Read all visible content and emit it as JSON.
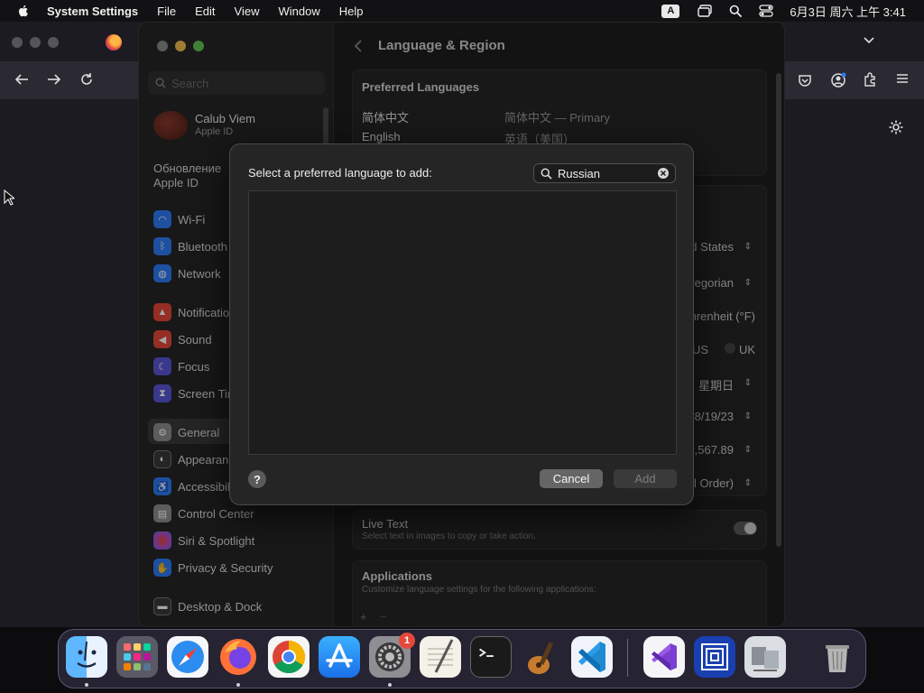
{
  "menubar": {
    "app_name": "System Settings",
    "menus": [
      "File",
      "Edit",
      "View",
      "Window",
      "Help"
    ],
    "input_source": "A",
    "clock": "6月3日 周六 上午 3:41"
  },
  "settings": {
    "search_placeholder": "Search",
    "account": {
      "name": "Calub Viem",
      "sub": "Apple ID"
    },
    "update_notice": "Обновление Apple ID",
    "sidebar": [
      {
        "label": "Wi-Fi",
        "color": "#2d7cf6"
      },
      {
        "label": "Bluetooth",
        "color": "#2d7cf6"
      },
      {
        "label": "Network",
        "color": "#2d7cf6"
      },
      {
        "label": "Notifications",
        "color": "#e5483a"
      },
      {
        "label": "Sound",
        "color": "#e5483a"
      },
      {
        "label": "Focus",
        "color": "#5856d6"
      },
      {
        "label": "Screen Time",
        "color": "#5856d6"
      },
      {
        "label": "General",
        "color": "#8e8e93"
      },
      {
        "label": "Appearance",
        "color": "#3a3a3c"
      },
      {
        "label": "Accessibility",
        "color": "#2d7cf6"
      },
      {
        "label": "Control Center",
        "color": "#8e8e93"
      },
      {
        "label": "Siri & Spotlight",
        "color": "#b34fd0"
      },
      {
        "label": "Privacy & Security",
        "color": "#2d7cf6"
      },
      {
        "label": "Desktop & Dock",
        "color": "#3a3a3c"
      }
    ],
    "content": {
      "title": "Language & Region",
      "preferred_heading": "Preferred Languages",
      "languages": [
        {
          "name": "简体中文",
          "detail": "简体中文 — Primary"
        },
        {
          "name": "English",
          "detail": "英语（美国）"
        }
      ],
      "region_values": [
        "United States",
        "Gregorian",
        "Fahrenheit (°F)",
        "星期日",
        "8/19/23",
        "1,567.89",
        "(Alphabetical Order)"
      ],
      "measurement": {
        "us": "US",
        "uk": "UK"
      },
      "live_text": {
        "title": "Live Text",
        "desc": "Select text in images to copy or take action."
      },
      "applications": {
        "title": "Applications",
        "desc": "Customize language settings for the following applications:"
      }
    }
  },
  "dialog": {
    "prompt": "Select a preferred language to add:",
    "search_value": "Russian",
    "help": "?",
    "cancel": "Cancel",
    "add": "Add"
  },
  "dock": {
    "apps": [
      "Finder",
      "Launchpad",
      "Safari",
      "Firefox",
      "Chrome",
      "App Store",
      "System Settings",
      "TextEdit",
      "Terminal",
      "GarageBand",
      "VS Code",
      "Visual Studio",
      "Hex Fiend",
      "Migration Assistant",
      "Trash"
    ],
    "settings_badge": "1"
  }
}
